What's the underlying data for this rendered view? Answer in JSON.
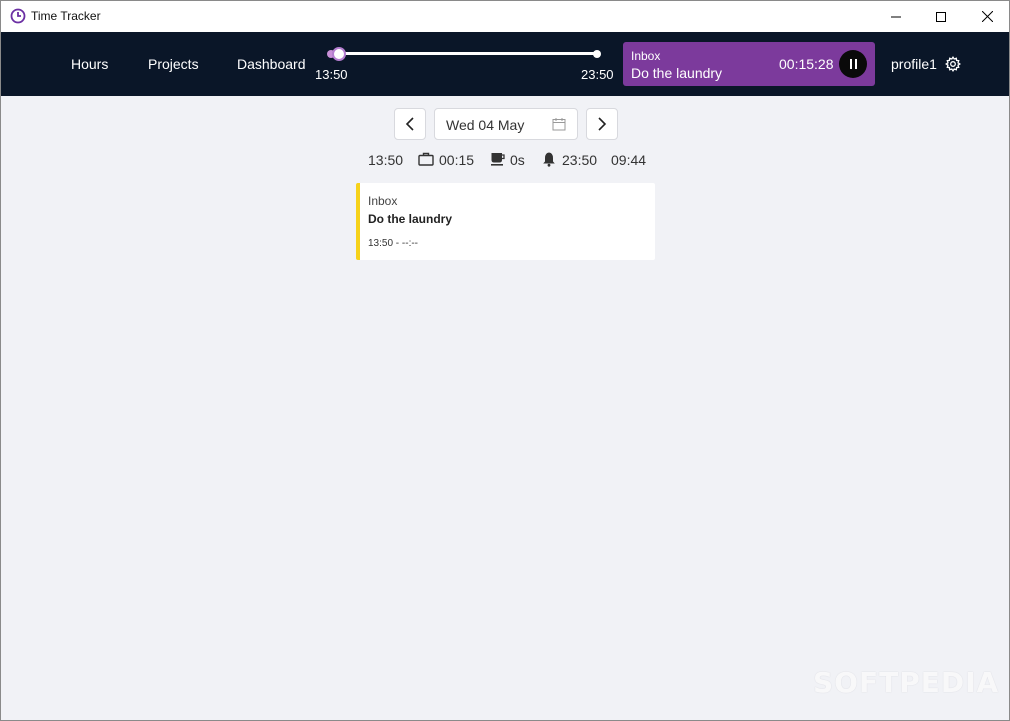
{
  "window": {
    "title": "Time Tracker"
  },
  "nav": {
    "hours": "Hours",
    "projects": "Projects",
    "dashboard": "Dashboard"
  },
  "day_slider": {
    "start_label": "13:50",
    "end_label": "23:50",
    "progress_fraction": 0.03
  },
  "active_timer": {
    "project": "Inbox",
    "task": "Do the laundry",
    "elapsed": "00:15:28",
    "background_color": "#7c3a9c"
  },
  "profile": {
    "name": "profile1"
  },
  "date_nav": {
    "date": "Wed 04 May"
  },
  "summary": {
    "start": "13:50",
    "work": "00:15",
    "break": "0s",
    "end": "23:50",
    "remaining": "09:44"
  },
  "entries": [
    {
      "project": "Inbox",
      "task": "Do the laundry",
      "time": "13:50 - --:--",
      "color": "#f6d21a"
    }
  ],
  "watermark": "SOFTPEDIA"
}
